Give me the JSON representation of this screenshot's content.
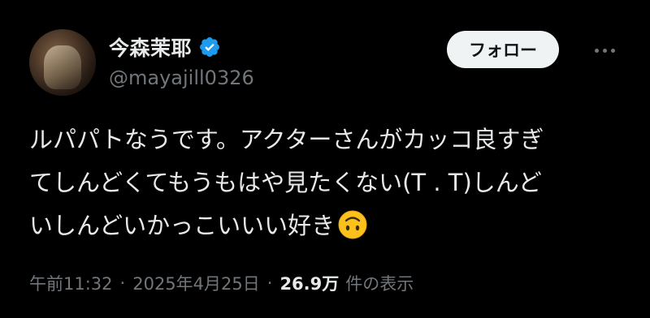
{
  "user": {
    "display_name": "今森茉耶",
    "handle": "@mayajill0326",
    "verified": true,
    "verified_color": "#1d9bf0"
  },
  "actions": {
    "follow_label": "フォロー",
    "more_icon": "ellipsis-icon"
  },
  "tweet": {
    "lines": [
      "ルパパトなうです。アクターさんがカッコ良すぎ",
      "てしんどくてもうもはや見たくない(T . T)しんど",
      "いしんどいかっこいいい好き"
    ],
    "emoji": "upside-down-face-emoji"
  },
  "meta": {
    "time": "午前11:32",
    "separator": "·",
    "date": "2025年4月25日",
    "views_count": "26.9万",
    "views_label": "件の表示"
  },
  "colors": {
    "background": "#000000",
    "text_primary": "#e7e9ea",
    "text_secondary": "#71767b",
    "follow_button_bg": "#eff3f4",
    "follow_button_text": "#0f1419"
  }
}
